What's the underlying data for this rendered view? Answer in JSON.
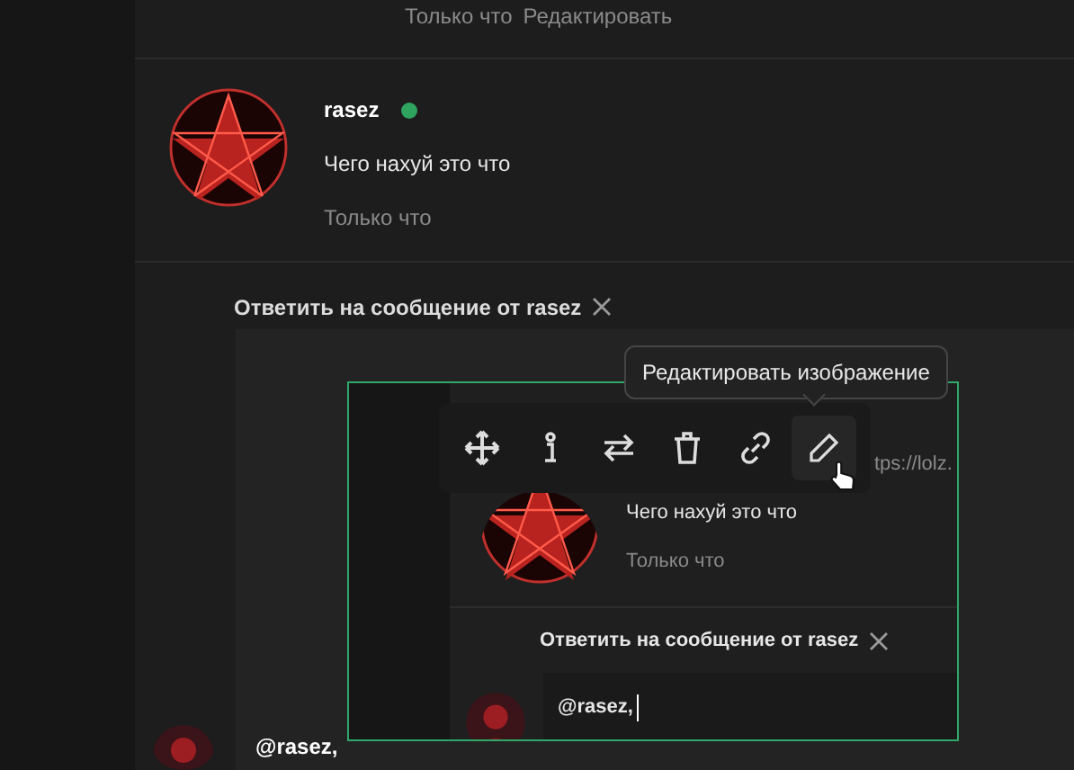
{
  "top_meta": {
    "time": "Только что",
    "edit_link": "Редактировать"
  },
  "post": {
    "username": "rasez",
    "online": true,
    "message": "Чего нахуй это что",
    "time": "Только что"
  },
  "reply_bar": {
    "label": "Ответить на сообщение от **rasez**"
  },
  "editor": {
    "image": {
      "url_fragment": "tps://lolz.",
      "message": "Чего нахуй это что",
      "time": "Только что",
      "reply_label": "Ответить на сообщение от **rasez**",
      "input_value": "@rasez,"
    },
    "toolbar": [
      {
        "kind": "move",
        "hovered": false
      },
      {
        "kind": "info",
        "hovered": false
      },
      {
        "kind": "swap",
        "hovered": false
      },
      {
        "kind": "delete",
        "hovered": false
      },
      {
        "kind": "link",
        "hovered": false
      },
      {
        "kind": "edit",
        "hovered": true
      }
    ],
    "tooltip": "Редактировать изображение",
    "value": "@rasez,"
  }
}
